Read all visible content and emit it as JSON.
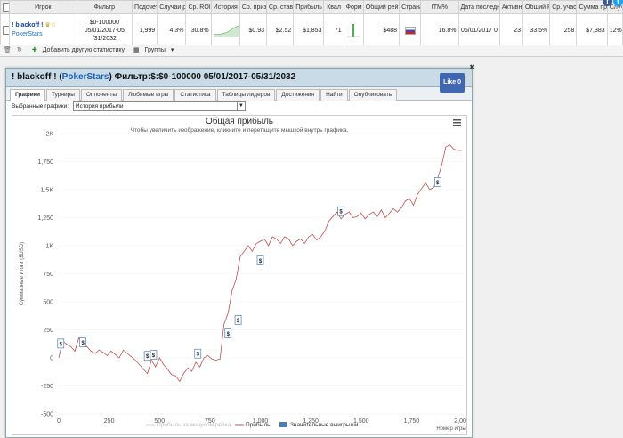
{
  "table": {
    "headers": [
      "Игрок",
      "Фильтр",
      "Подсчет",
      "Случаи р",
      "Ср. ROI",
      "История",
      "Ср. приз",
      "Ср. став",
      "Прибыль",
      "Квал",
      "Форм",
      "Общий рей",
      "Страна",
      "ITM%",
      "Дата последн",
      "Активн",
      "Общий R",
      "Ср. учас",
      "Сумма пр",
      "Случ"
    ],
    "row": {
      "player_name": "! blackoff !",
      "player_site": "PokerStars",
      "filter_line1": "$0-100000",
      "filter_line2": "05/01/2017-05",
      "filter_line3": "/31/2032",
      "count": "1,999",
      "chance": "4.3%",
      "roi": "30.8%",
      "avg_prize": "$0.93",
      "avg_stake": "$2.52",
      "profit": "$1,853",
      "qual": "71",
      "total_rating": "$488",
      "itm": "16.8%",
      "last_date": "06/01/2017 0",
      "active": "23",
      "total_r": "33.5%",
      "avg_part": "258",
      "sum_prize": "$7,383",
      "chance2": "12%"
    }
  },
  "toolbar": {
    "add_stats": "Добавить другую статистику",
    "groups": "Группы"
  },
  "panel": {
    "title_prefix": "! blackoff ! (",
    "site": "PokerStars",
    "title_suffix": ") Фильтр:$:$0-100000 05/01/2017-05/31/2032",
    "like": "Like 0",
    "tabs": [
      "Графики",
      "Турниры",
      "Оппоненты",
      "Любимые игры",
      "Статистика",
      "Таблицы лидеров",
      "Достижения",
      "Найти",
      "Опубликовать"
    ],
    "selected_label": "Выбранные графики:",
    "selected_value": "История прибыли"
  },
  "chart_data": {
    "type": "line",
    "title": "Общая прибыль",
    "subtitle": "Чтобы увеличить изображение, кликните и перетащите мышкой внутрь графика.",
    "xlabel": "Номер игры",
    "ylabel": "Суммарные итоги ($USD)",
    "xlim": [
      0,
      2000
    ],
    "ylim": [
      -500,
      2000
    ],
    "x_ticks": [
      "0",
      "250",
      "500",
      "750",
      "1,000",
      "1,250",
      "1,500",
      "1,750",
      "2,000"
    ],
    "y_ticks": [
      "2K",
      "1,750",
      "1.5K",
      "1,250",
      "1K",
      "750",
      "500",
      "250",
      "0",
      "-250",
      "-500"
    ],
    "series": [
      {
        "name": "Прибыль",
        "color": "#c0504d",
        "x": [
          0,
          20,
          40,
          60,
          80,
          100,
          120,
          140,
          160,
          180,
          200,
          220,
          240,
          260,
          280,
          300,
          320,
          340,
          360,
          380,
          400,
          420,
          440,
          460,
          480,
          500,
          520,
          540,
          560,
          580,
          600,
          620,
          640,
          660,
          680,
          700,
          720,
          740,
          760,
          780,
          800,
          820,
          840,
          860,
          880,
          900,
          920,
          940,
          960,
          980,
          1000,
          1020,
          1040,
          1060,
          1080,
          1100,
          1120,
          1140,
          1160,
          1180,
          1200,
          1220,
          1240,
          1260,
          1280,
          1300,
          1320,
          1340,
          1360,
          1380,
          1400,
          1420,
          1440,
          1460,
          1480,
          1500,
          1520,
          1540,
          1560,
          1580,
          1600,
          1620,
          1640,
          1660,
          1680,
          1700,
          1720,
          1740,
          1760,
          1780,
          1800,
          1820,
          1840,
          1860,
          1880,
          1900,
          1920,
          1940,
          1960,
          1980,
          2000
        ],
        "y": [
          0,
          150,
          120,
          100,
          60,
          180,
          130,
          100,
          60,
          40,
          70,
          50,
          20,
          60,
          30,
          0,
          70,
          40,
          10,
          -20,
          -60,
          -100,
          -140,
          -20,
          -80,
          0,
          -60,
          -100,
          -150,
          -160,
          -210,
          -140,
          -90,
          -120,
          -40,
          -80,
          0,
          20,
          -10,
          -20,
          -10,
          300,
          400,
          600,
          700,
          900,
          950,
          1000,
          950,
          1020,
          1040,
          1060,
          1000,
          1080,
          1060,
          1020,
          1080,
          1060,
          1000,
          1040,
          1060,
          1020,
          1080,
          1100,
          1050,
          1080,
          1130,
          1220,
          1260,
          1300,
          1240,
          1280,
          1300,
          1250,
          1260,
          1290,
          1240,
          1280,
          1300,
          1260,
          1320,
          1250,
          1290,
          1330,
          1300,
          1340,
          1400,
          1420,
          1360,
          1460,
          1510,
          1560,
          1500,
          1520,
          1600,
          1720,
          1880,
          1900,
          1860,
          1850,
          1850
        ]
      }
    ],
    "legend": [
      "Прибыль за минусом рейка",
      "Прибыль",
      "Значительные выигрыши"
    ],
    "legend_colors": [
      "#e8c8c8",
      "#c0504d",
      "#4a7ebb"
    ],
    "markers": [
      {
        "x": 10,
        "y": 120
      },
      {
        "x": 120,
        "y": 130
      },
      {
        "x": 440,
        "y": 10
      },
      {
        "x": 470,
        "y": 20
      },
      {
        "x": 690,
        "y": 30
      },
      {
        "x": 840,
        "y": 210
      },
      {
        "x": 890,
        "y": 330
      },
      {
        "x": 1000,
        "y": 860
      },
      {
        "x": 1400,
        "y": 1300
      },
      {
        "x": 1880,
        "y": 1560
      }
    ]
  }
}
